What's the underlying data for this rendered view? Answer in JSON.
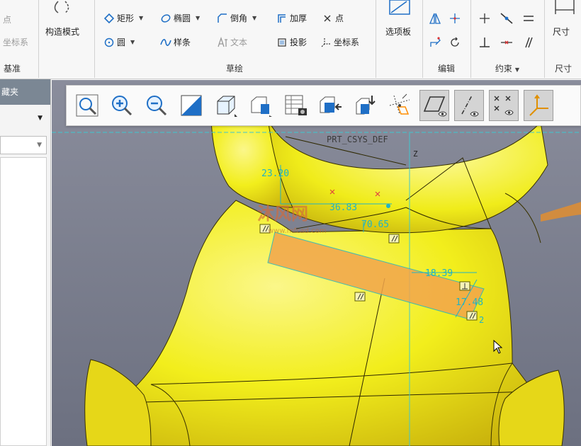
{
  "ribbon": {
    "datum_group": {
      "label": "基准",
      "items": [
        "点",
        "坐标系"
      ]
    },
    "construction_mode": {
      "label": "构造模式"
    },
    "sketch_group": {
      "label": "草绘",
      "items": {
        "rectangle": "矩形",
        "ellipse": "椭圆",
        "chamfer": "倒角",
        "thicken": "加厚",
        "point": "点",
        "circle": "圆",
        "spline": "样条",
        "text": "文本",
        "project": "投影",
        "csys": "坐标系"
      }
    },
    "palette": {
      "label": "选项板"
    },
    "edit_group": {
      "label": "编辑"
    },
    "constrain_group": {
      "label": "约束"
    },
    "dimension_group": {
      "label": "尺寸",
      "item": "尺寸"
    }
  },
  "left_panel": {
    "header": "藏夹"
  },
  "viewport": {
    "csys_label": "PRT_CSYS_DEF",
    "axis_label": "Z",
    "dimensions": [
      "23.20",
      "36.83",
      "70.65",
      "18.39",
      "17.48"
    ],
    "constraint_suffix": "2",
    "watermark": {
      "brand": "沐风网",
      "url": "www.mfcad.com"
    },
    "colors": {
      "part": "#f2ee1c",
      "background": "#7b7f8e",
      "sketch": "#21b3c4",
      "sketch_fill": "#f2a54c"
    }
  },
  "view_toolbar": {
    "buttons": [
      {
        "name": "refit-icon"
      },
      {
        "name": "zoom-in-icon"
      },
      {
        "name": "zoom-out-icon"
      },
      {
        "name": "repaint-icon"
      },
      {
        "name": "display-style-icon"
      },
      {
        "name": "saved-orientations-icon"
      },
      {
        "name": "view-manager-icon"
      },
      {
        "name": "sketch-view-icon"
      },
      {
        "name": "annotation-display-icon"
      },
      {
        "name": "datum-display-icon"
      },
      {
        "name": "plane-display-icon",
        "active": true
      },
      {
        "name": "axis-display-icon",
        "active": true
      },
      {
        "name": "point-display-icon",
        "active": true
      },
      {
        "name": "csys-display-icon",
        "active": true
      }
    ]
  }
}
